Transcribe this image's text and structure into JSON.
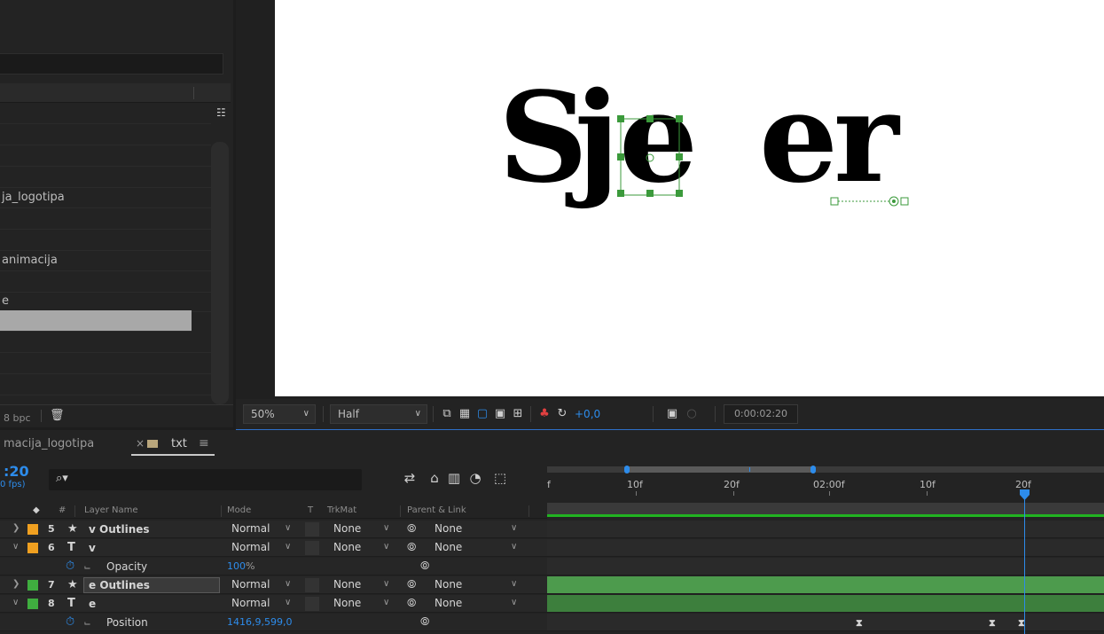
{
  "project": {
    "rows": [
      "ja_logotipa",
      "animacija",
      "e"
    ],
    "bpc": "8 bpc"
  },
  "composition": {
    "letters": [
      "S",
      "j",
      "e",
      "e",
      "r"
    ]
  },
  "viewer_toolbar": {
    "zoom": "50%",
    "resolution": "Half",
    "exposure": "+0,0",
    "timecode": "0:00:02:20"
  },
  "timeline": {
    "tabs": [
      {
        "label": "macija_logotipa"
      },
      {
        "label": "txt",
        "active": true
      }
    ],
    "current_time": ":20",
    "fps": "0 fps)",
    "search_placeholder": "",
    "ruler_labels": [
      "f",
      "10f",
      "20f",
      "02:00f",
      "10f",
      "20f"
    ],
    "column_headers": {
      "hash": "#",
      "layer_name": "Layer Name",
      "mode": "Mode",
      "t": "T",
      "trkmat": "TrkMat",
      "parent": "Parent & Link"
    },
    "layers": [
      {
        "num": "5",
        "type": "★",
        "name": "v Outlines",
        "mode": "Normal",
        "trkmat": "None",
        "parent": "None",
        "color": "#f0a020",
        "expanded": false
      },
      {
        "num": "6",
        "type": "T",
        "name": "v",
        "mode": "Normal",
        "trkmat": "None",
        "parent": "None",
        "color": "#f0a020",
        "expanded": true
      },
      {
        "num": "7",
        "type": "★",
        "name": "e Outlines",
        "mode": "Normal",
        "trkmat": "None",
        "parent": "None",
        "color": "#3fae3f",
        "expanded": false,
        "selected": true
      },
      {
        "num": "8",
        "type": "T",
        "name": "e",
        "mode": "Normal",
        "trkmat": "None",
        "parent": "None",
        "color": "#3fae3f",
        "expanded": true
      }
    ],
    "properties": [
      {
        "name": "Opacity",
        "value": "100",
        "unit": "%"
      },
      {
        "name": "Position",
        "value": "1416,9,599,0",
        "unit": ""
      }
    ]
  }
}
